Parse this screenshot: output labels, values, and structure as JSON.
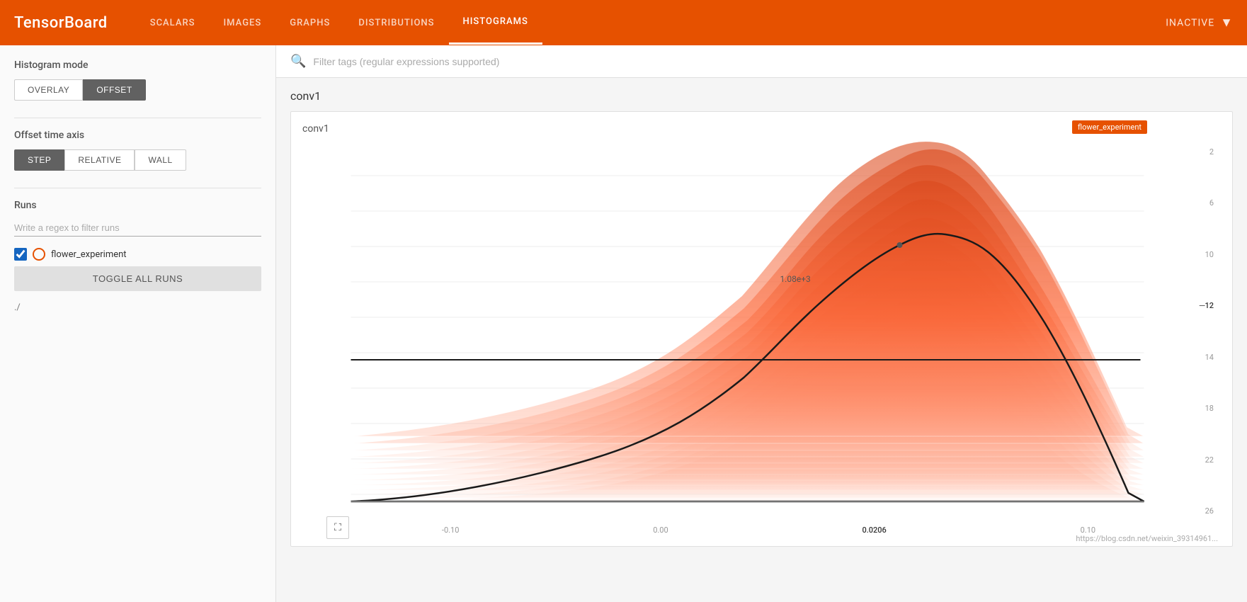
{
  "topbar": {
    "logo": "TensorBoard",
    "nav_items": [
      {
        "label": "SCALARS",
        "active": false
      },
      {
        "label": "IMAGES",
        "active": false
      },
      {
        "label": "GRAPHS",
        "active": false
      },
      {
        "label": "DISTRIBUTIONS",
        "active": false
      },
      {
        "label": "HISTOGRAMS",
        "active": true
      }
    ],
    "status": "INACTIVE"
  },
  "sidebar": {
    "histogram_mode_label": "Histogram mode",
    "overlay_label": "OVERLAY",
    "offset_label": "OFFSET",
    "offset_time_axis_label": "Offset time axis",
    "step_label": "STEP",
    "relative_label": "RELATIVE",
    "wall_label": "WALL",
    "runs_label": "Runs",
    "regex_placeholder": "Write a regex to filter runs",
    "run_name": "flower_experiment",
    "toggle_all_label": "TOGGLE ALL RUNS",
    "subdir": "./"
  },
  "search": {
    "placeholder": "Filter tags (regular expressions supported)"
  },
  "chart_group": {
    "title": "conv1"
  },
  "chart": {
    "title": "conv1",
    "legend_badge": "flower_experiment",
    "tooltip_value": "1.08e+3",
    "x_labels": [
      "-0.10",
      "0.00",
      "0.0206",
      "0.10"
    ],
    "y_labels": [
      "2",
      "6",
      "10",
      "-12",
      "14",
      "18",
      "22",
      "26"
    ],
    "y_highlighted": "-12"
  },
  "url_hint": "https://blog.csdn.net/weixin_39314961..."
}
